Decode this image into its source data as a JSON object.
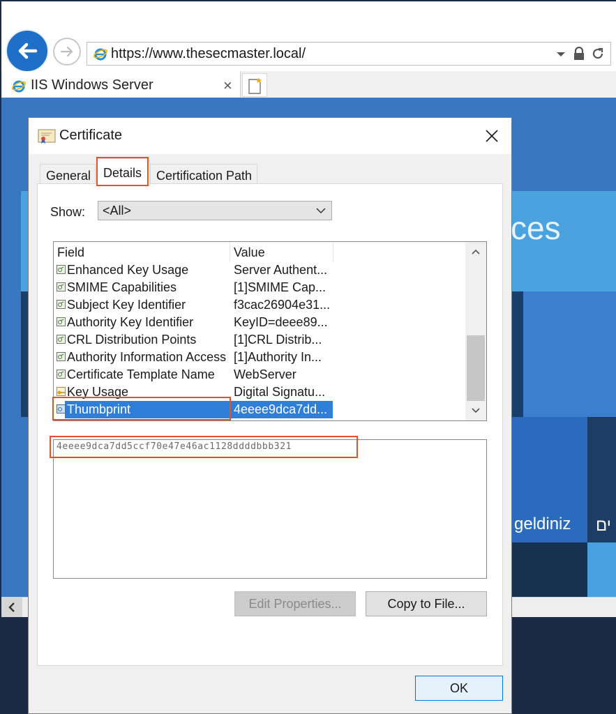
{
  "browser": {
    "url": "https://www.thesecmaster.local/",
    "tab_title": "IIS Windows Server",
    "tab_close": "×"
  },
  "page": {
    "text_ces": "ces",
    "text_geldiniz": "geldiniz",
    "text_hebrew": "ים"
  },
  "dialog": {
    "title": "Certificate",
    "tabs": [
      {
        "label": "General"
      },
      {
        "label": "Details"
      },
      {
        "label": "Certification Path"
      }
    ],
    "active_tab": "Details",
    "show_label": "Show:",
    "show_value": "<All>",
    "columns": {
      "field": "Field",
      "value": "Value"
    },
    "rows": [
      {
        "field": "Enhanced Key Usage",
        "value": "Server Authent..."
      },
      {
        "field": "SMIME Capabilities",
        "value": "[1]SMIME Cap..."
      },
      {
        "field": "Subject Key Identifier",
        "value": "f3cac26904e31..."
      },
      {
        "field": "Authority Key Identifier",
        "value": "KeyID=deee89..."
      },
      {
        "field": "CRL Distribution Points",
        "value": "[1]CRL Distrib..."
      },
      {
        "field": "Authority Information Access",
        "value": "[1]Authority In..."
      },
      {
        "field": "Certificate Template Name",
        "value": "WebServer"
      },
      {
        "field": "Key Usage",
        "value": "Digital Signatu..."
      },
      {
        "field": "Thumbprint",
        "value": "4eeee9dca7dd..."
      }
    ],
    "selected_field": "Thumbprint",
    "detail_value": "4eeee9dca7dd5ccf70e47e46ac1128ddddbbb321",
    "edit_properties_label": "Edit Properties...",
    "copy_to_file_label": "Copy to File...",
    "ok_label": "OK"
  },
  "colors": {
    "accent": "#0078d7",
    "selection": "#2f7fd8",
    "highlight": "#e2532c"
  }
}
